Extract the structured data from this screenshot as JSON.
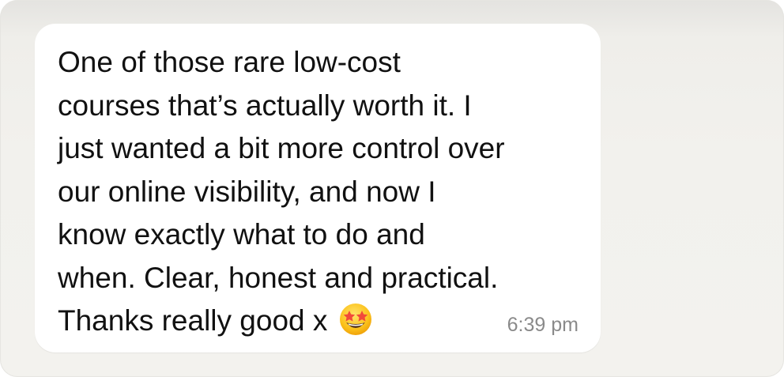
{
  "message": {
    "lines": [
      "One of those rare low-cost",
      "courses that’s actually worth it. I",
      "just wanted a bit more control over",
      "our online visibility, and now I",
      "know exactly what to do and",
      "when. Clear, honest and practical.",
      "Thanks really good x"
    ],
    "emoji": "star-struck-emoji",
    "timestamp": "6:39 pm"
  },
  "colors": {
    "bubble": "#ffffff",
    "background": "#f2f1ed",
    "text": "#111111",
    "timestamp": "#8a8a8a"
  }
}
